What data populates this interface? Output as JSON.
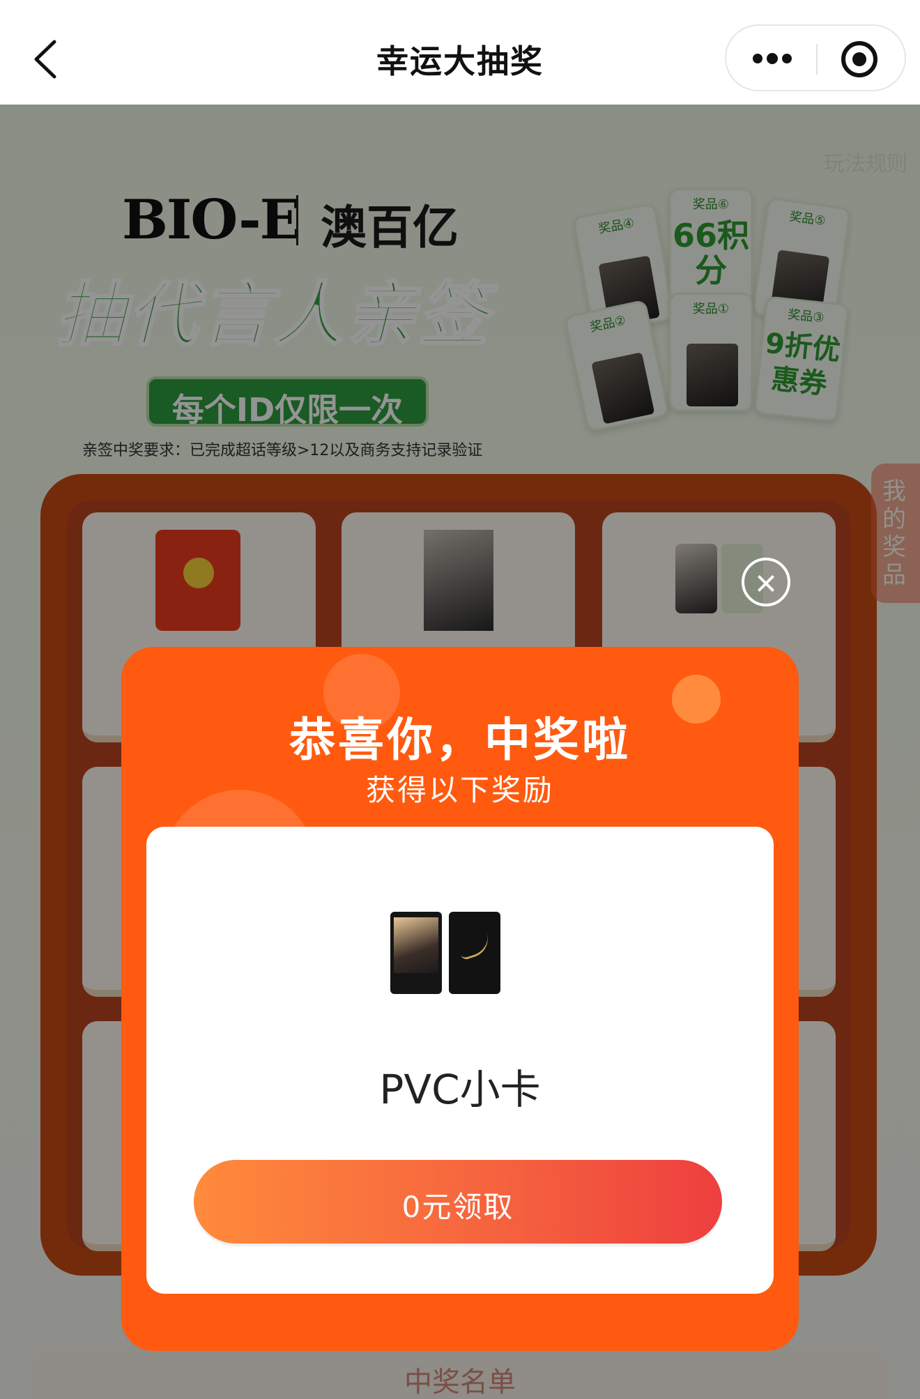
{
  "nav": {
    "title": "幸运大抽奖"
  },
  "banner": {
    "rules_link": "玩法规则",
    "brand_en": "BIO-E",
    "brand_cn": "澳百亿",
    "headline": "抽代言人亲签",
    "limit": "每个ID仅限一次",
    "requirement": "亲签中奖要求：已完成超话等级>12以及商务支持记录验证",
    "prize_cards": [
      {
        "tag": "奖品④",
        "main": ""
      },
      {
        "tag": "奖品⑥",
        "main": "66积分"
      },
      {
        "tag": "奖品⑤",
        "main": ""
      },
      {
        "tag": "奖品②",
        "main": ""
      },
      {
        "tag": "奖品①",
        "main": ""
      },
      {
        "tag": "奖品③",
        "main": "9折优惠券"
      }
    ]
  },
  "side_tab": {
    "label": "我的奖品"
  },
  "winners": {
    "label": "中奖名单"
  },
  "modal": {
    "title": "恭喜你，中奖啦",
    "subtitle": "获得以下奖励",
    "reward_name": "PVC小卡",
    "claim_label": "0元领取"
  },
  "colors": {
    "modal_bg": "#ff5a0f",
    "button_start": "#ff8a3c",
    "button_end": "#ee3f3f",
    "headline_green": "#3aa13a"
  }
}
